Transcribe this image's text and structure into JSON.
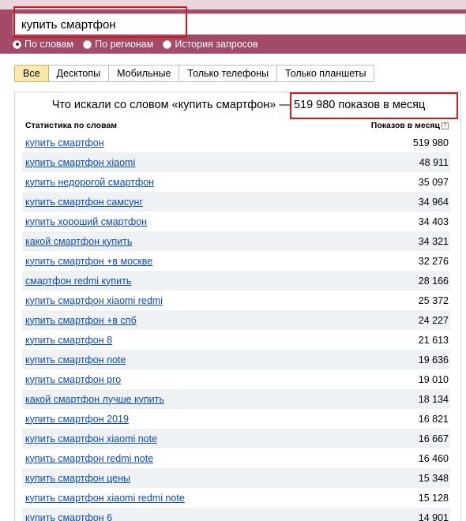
{
  "search": {
    "value": "купить смартфон"
  },
  "radios": [
    {
      "label": "По словам",
      "selected": true
    },
    {
      "label": "По регионам",
      "selected": false
    },
    {
      "label": "История запросов",
      "selected": false
    }
  ],
  "tabs": [
    {
      "label": "Все",
      "active": true
    },
    {
      "label": "Десктопы",
      "active": false
    },
    {
      "label": "Мобильные",
      "active": false
    },
    {
      "label": "Только телефоны",
      "active": false
    },
    {
      "label": "Только планшеты",
      "active": false
    }
  ],
  "summary": {
    "prefix": "Что искали со словом «купить смартфон» —",
    "count": "519 980 показов в месяц"
  },
  "table": {
    "col_phrase": "Статистика по словам",
    "col_count": "Показов в месяц",
    "help_icon": "?",
    "rows": [
      {
        "phrase": "купить смартфон",
        "count": "519 980"
      },
      {
        "phrase": "купить смартфон xiaomi",
        "count": "48 911"
      },
      {
        "phrase": "купить недорогой смартфон",
        "count": "35 097"
      },
      {
        "phrase": "купить смартфон самсунг",
        "count": "34 964"
      },
      {
        "phrase": "купить хороший смартфон",
        "count": "34 403"
      },
      {
        "phrase": "какой смартфон купить",
        "count": "34 321"
      },
      {
        "phrase": "купить смартфон +в москве",
        "count": "32 276"
      },
      {
        "phrase": "смартфон redmi купить",
        "count": "28 166"
      },
      {
        "phrase": "купить смартфон xiaomi redmi",
        "count": "25 372"
      },
      {
        "phrase": "купить смартфон +в спб",
        "count": "24 227"
      },
      {
        "phrase": "купить смартфон 8",
        "count": "21 613"
      },
      {
        "phrase": "купить смартфон note",
        "count": "19 636"
      },
      {
        "phrase": "купить смартфон pro",
        "count": "19 010"
      },
      {
        "phrase": "какой смартфон лучше купить",
        "count": "18 134"
      },
      {
        "phrase": "купить смартфон 2019",
        "count": "16 821"
      },
      {
        "phrase": "купить смартфон xiaomi note",
        "count": "16 667"
      },
      {
        "phrase": "купить смартфон redmi note",
        "count": "16 460"
      },
      {
        "phrase": "купить смартфон цены",
        "count": "15 348"
      },
      {
        "phrase": "купить смартфон xiaomi redmi note",
        "count": "15 128"
      },
      {
        "phrase": "купить смартфон 6",
        "count": "14 901"
      }
    ]
  }
}
